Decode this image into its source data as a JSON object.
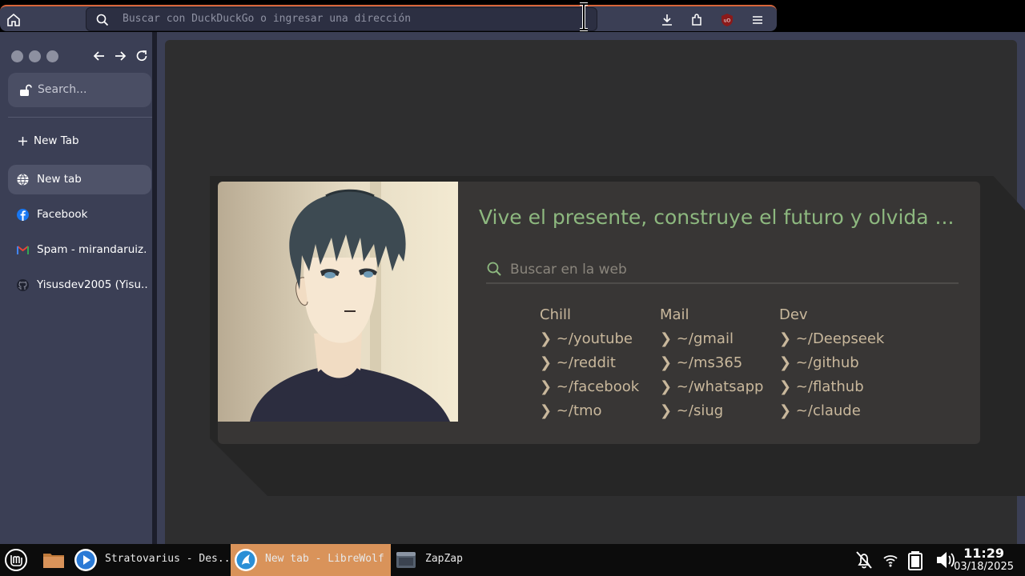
{
  "browser": {
    "url_placeholder": "Buscar con DuckDuckGo o ingresar una dirección"
  },
  "sidebar": {
    "search_placeholder": "Search...",
    "new_tab_label": "New Tab",
    "tabs": [
      {
        "label": "New tab",
        "icon": "globe-icon",
        "active": true
      },
      {
        "label": "Facebook",
        "icon": "facebook-icon",
        "active": false
      },
      {
        "label": "Spam - mirandaruiz...",
        "icon": "gmail-icon",
        "active": false
      },
      {
        "label": "Yisusdev2005 (Yisu...",
        "icon": "github-icon",
        "active": false
      }
    ]
  },
  "startpage": {
    "tagline": "Vive el presente, construye el futuro y olvida ...",
    "search_placeholder": "Buscar en la web",
    "columns": [
      {
        "title": "Chill",
        "links": [
          "❯ ~/youtube",
          "❯ ~/reddit",
          "❯ ~/facebook",
          "❯ ~/tmo"
        ]
      },
      {
        "title": "Mail",
        "links": [
          "❯ ~/gmail",
          "❯ ~/ms365",
          "❯ ~/whatsapp",
          "❯ ~/siug"
        ]
      },
      {
        "title": "Dev",
        "links": [
          "❯ ~/Deepseek",
          "❯ ~/github",
          "❯ ~/flathub",
          "❯ ~/claude"
        ]
      }
    ]
  },
  "taskbar": {
    "tasks": [
      {
        "label": "Stratovarius - Des...",
        "icon": "media-player-icon"
      },
      {
        "label": "New tab - LibreWolf",
        "icon": "librewolf-icon",
        "active": true
      },
      {
        "label": "ZapZap",
        "icon": "window-icon"
      }
    ],
    "time": "11:29",
    "date": "03/18/2025"
  },
  "colors": {
    "accent": "#d9663a",
    "sidebar_bg": "#3b3f55",
    "tagline": "#8db87f",
    "link_text": "#c9b89c",
    "active_task": "#d9935a"
  }
}
